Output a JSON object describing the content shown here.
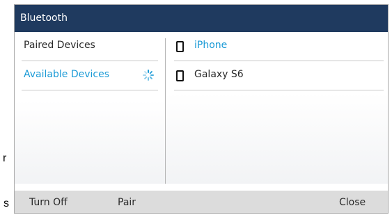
{
  "window": {
    "title": "Bluetooth"
  },
  "stray_text": [
    "r",
    "s"
  ],
  "menu": {
    "items": [
      {
        "label": "Paired Devices",
        "selected": false
      },
      {
        "label": "Available Devices",
        "selected": true,
        "loading_icon": "spinner-icon"
      }
    ]
  },
  "devices": [
    {
      "name": "iPhone",
      "icon": "mobile-phone-icon",
      "highlighted": true
    },
    {
      "name": "Galaxy S6",
      "icon": "mobile-phone-icon",
      "highlighted": false
    }
  ],
  "softkeys": [
    {
      "label": "Turn Off"
    },
    {
      "label": "Pair"
    },
    {
      "label": "Close"
    }
  ],
  "colors": {
    "titlebar": "#1f3a5f",
    "accent": "#1a9ad6",
    "softkey_bar": "#dcdcdc",
    "text": "#2a2a2a"
  }
}
